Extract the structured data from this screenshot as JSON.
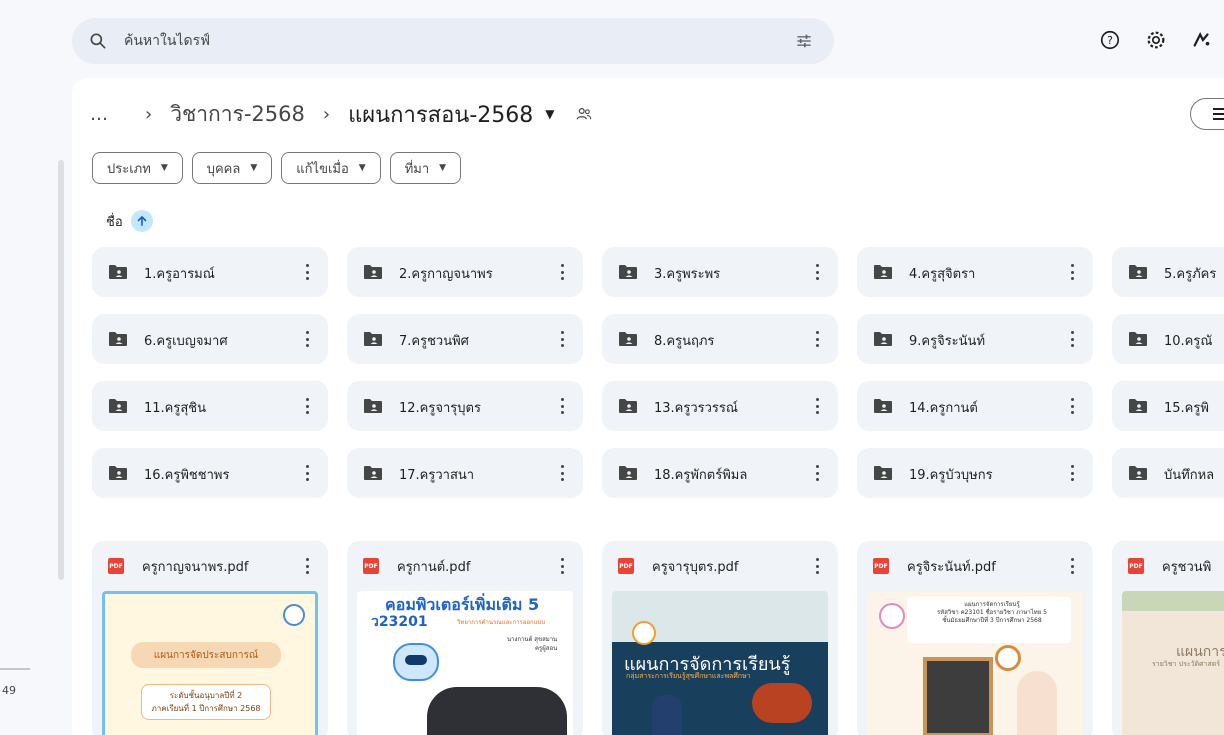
{
  "search": {
    "placeholder": "ค้นหาในไดรฟ์"
  },
  "breadcrumb": {
    "more": "…",
    "parent": "วิชาการ-2568",
    "current": "แผนการสอน-2568"
  },
  "filters": [
    "ประเภท",
    "บุคคล",
    "แก้ไขเมื่อ",
    "ที่มา"
  ],
  "sort": {
    "label": "ชื่อ"
  },
  "folders": [
    [
      "1.ครูอารมณ์",
      "2.ครูกาญจนาพร",
      "3.ครูพระพร",
      "4.ครูสุจิตรา",
      "5.ครูภัคร"
    ],
    [
      "6.ครูเบญจมาศ",
      "7.ครูชวนพิศ",
      "8.ครูนฤภร",
      "9.ครูจิระนันท์",
      "10.ครูณั"
    ],
    [
      "11.ครูสุชิน",
      "12.ครูจารุบุตร",
      "13.ครูวรวรรณ์",
      "14.ครูกานต์",
      "15.ครูพิ"
    ],
    [
      "16.ครูพิชชาพร",
      "17.ครูวาสนา",
      "18.ครูพักตร์พิมล",
      "19.ครูบัวบุษกร",
      "บันทึกหล"
    ]
  ],
  "files": [
    {
      "name": "ครูกาญจนาพร.pdf",
      "thumb": {
        "banner": "แผนการจัดประสบการณ์",
        "sub1": "ระดับชั้นอนุบาลปีที่ 2",
        "sub2": "ภาคเรียนที่ 1 ปีการศึกษา 2568"
      }
    },
    {
      "name": "ครูกานต์.pdf",
      "thumb": {
        "h1": "คอมพิวเตอร์เพิ่มเติม 5",
        "h2": "ว23201",
        "h3": "วิทยาการคำนวณและการออกแบบ",
        "name1": "นางกานต์ สุขสมาน",
        "name2": "ครูผู้สอน"
      }
    },
    {
      "name": "ครูจารุบุตร.pdf",
      "thumb": {
        "t1": "แผนการจัดการเรียนรู้",
        "t2": "กลุ่มสาระการเรียนรู้สุขศึกษาและพลศึกษา"
      }
    },
    {
      "name": "ครูจิระนันท์.pdf",
      "thumb": {
        "l1": "แผนการจัดการเรียนรู้",
        "l2": "รหัสวิชา ค23101 ชื่อรายวิชา ภาษาไทย 5",
        "l3": "ชั้นมัธยมศึกษาปีที่ 3 ปีการศึกษา 2568"
      }
    },
    {
      "name": "ครูชวนพิ",
      "thumb": {
        "t": "แผนการ",
        "t2": "รายวิชา ประวัติศาสตร์"
      }
    }
  ],
  "storage": {
    "text": "49"
  },
  "colors": {
    "accent": "#0b57d0",
    "pdf": "#ea4335",
    "folder_bg": "#f0f4f9",
    "sort_chip": "#c2e7ff"
  }
}
